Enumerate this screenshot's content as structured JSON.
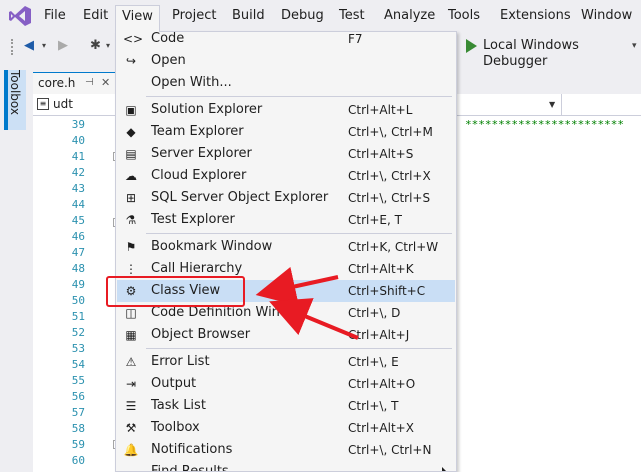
{
  "menubar": {
    "items": [
      "File",
      "Edit",
      "View",
      "Project",
      "Build",
      "Debug",
      "Test",
      "Analyze",
      "Tools",
      "Extensions",
      "Window"
    ],
    "active": "View"
  },
  "toolbar": {
    "debugger_label": "Local Windows Debugger"
  },
  "toolbox": {
    "label": "Toolbox"
  },
  "document": {
    "tab_label": "core.h",
    "nav_scope": "udt",
    "line_numbers": [
      "39",
      "40",
      "41",
      "42",
      "43",
      "44",
      "45",
      "46",
      "47",
      "48",
      "49",
      "50",
      "51",
      "52",
      "53",
      "54",
      "55",
      "56",
      "57",
      "58",
      "59",
      "60"
    ],
    "comment_stars": "************************"
  },
  "view_menu": {
    "items": [
      {
        "icon": "code-icon",
        "glyph": "<>",
        "label": "Code",
        "shortcut": "F7"
      },
      {
        "icon": "open-icon",
        "glyph": "↪",
        "label": "Open",
        "shortcut": ""
      },
      {
        "icon": "",
        "glyph": "",
        "label": "Open With...",
        "shortcut": ""
      },
      {
        "icon": "solution-explorer-icon",
        "glyph": "▣",
        "label": "Solution Explorer",
        "shortcut": "Ctrl+Alt+L"
      },
      {
        "icon": "team-explorer-icon",
        "glyph": "◆",
        "label": "Team Explorer",
        "shortcut": "Ctrl+\\, Ctrl+M"
      },
      {
        "icon": "server-explorer-icon",
        "glyph": "▤",
        "label": "Server Explorer",
        "shortcut": "Ctrl+Alt+S"
      },
      {
        "icon": "cloud-explorer-icon",
        "glyph": "☁",
        "label": "Cloud Explorer",
        "shortcut": "Ctrl+\\, Ctrl+X"
      },
      {
        "icon": "sql-explorer-icon",
        "glyph": "⊞",
        "label": "SQL Server Object Explorer",
        "shortcut": "Ctrl+\\, Ctrl+S"
      },
      {
        "icon": "test-explorer-icon",
        "glyph": "⚗",
        "label": "Test Explorer",
        "shortcut": "Ctrl+E, T"
      },
      {
        "icon": "bookmark-icon",
        "glyph": "⚑",
        "label": "Bookmark Window",
        "shortcut": "Ctrl+K, Ctrl+W"
      },
      {
        "icon": "call-hierarchy-icon",
        "glyph": "⋮",
        "label": "Call Hierarchy",
        "shortcut": "Ctrl+Alt+K"
      },
      {
        "icon": "class-view-icon",
        "glyph": "⚙",
        "label": "Class View",
        "shortcut": "Ctrl+Shift+C"
      },
      {
        "icon": "code-definition-icon",
        "glyph": "◫",
        "label": "Code Definition Window",
        "shortcut": "Ctrl+\\, D"
      },
      {
        "icon": "object-browser-icon",
        "glyph": "▦",
        "label": "Object Browser",
        "shortcut": "Ctrl+Alt+J"
      },
      {
        "icon": "error-list-icon",
        "glyph": "⚠",
        "label": "Error List",
        "shortcut": "Ctrl+\\, E"
      },
      {
        "icon": "output-icon",
        "glyph": "⇥",
        "label": "Output",
        "shortcut": "Ctrl+Alt+O"
      },
      {
        "icon": "task-list-icon",
        "glyph": "☰",
        "label": "Task List",
        "shortcut": "Ctrl+\\, T"
      },
      {
        "icon": "toolbox-icon",
        "glyph": "⚒",
        "label": "Toolbox",
        "shortcut": "Ctrl+Alt+X"
      },
      {
        "icon": "notifications-icon",
        "glyph": "🔔",
        "label": "Notifications",
        "shortcut": "Ctrl+\\, Ctrl+N"
      },
      {
        "icon": "find-results-icon",
        "glyph": "",
        "label": "Find Results",
        "shortcut": ""
      }
    ],
    "highlighted": "Class View"
  },
  "colors": {
    "accent": "#007acc",
    "highlight": "#c9def5",
    "annotation": "#e81b23",
    "line_number": "#2b91af",
    "comment": "#008000"
  }
}
